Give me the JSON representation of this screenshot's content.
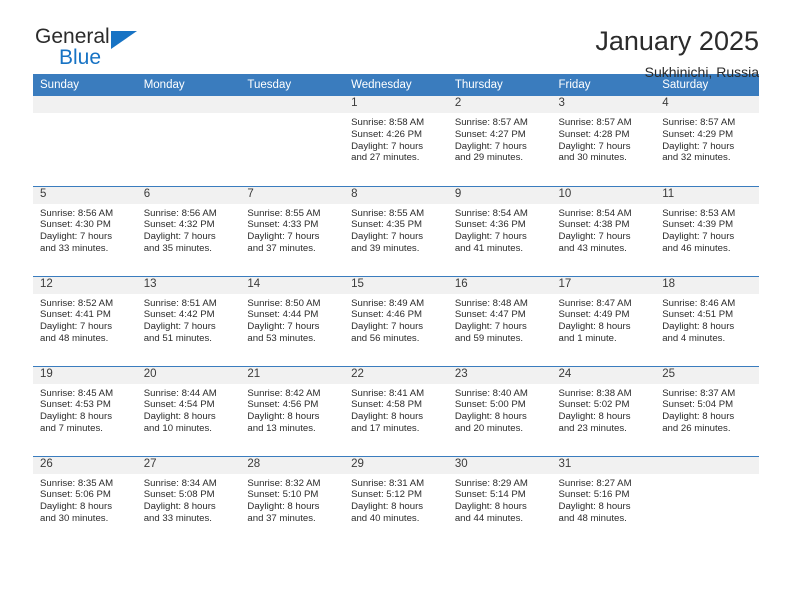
{
  "brand": {
    "name_part1": "General",
    "name_part2": "Blue",
    "accent_color": "#1773c4"
  },
  "header": {
    "title": "January 2025",
    "location": "Sukhinichi, Russia"
  },
  "calendar": {
    "header_color": "#3a7cbe",
    "weekdays": [
      "Sunday",
      "Monday",
      "Tuesday",
      "Wednesday",
      "Thursday",
      "Friday",
      "Saturday"
    ],
    "weeks": [
      [
        {
          "day": "",
          "sunrise": "",
          "sunset": "",
          "daylight_line1": "",
          "daylight_line2": ""
        },
        {
          "day": "",
          "sunrise": "",
          "sunset": "",
          "daylight_line1": "",
          "daylight_line2": ""
        },
        {
          "day": "",
          "sunrise": "",
          "sunset": "",
          "daylight_line1": "",
          "daylight_line2": ""
        },
        {
          "day": "1",
          "sunrise": "Sunrise: 8:58 AM",
          "sunset": "Sunset: 4:26 PM",
          "daylight_line1": "Daylight: 7 hours",
          "daylight_line2": "and 27 minutes."
        },
        {
          "day": "2",
          "sunrise": "Sunrise: 8:57 AM",
          "sunset": "Sunset: 4:27 PM",
          "daylight_line1": "Daylight: 7 hours",
          "daylight_line2": "and 29 minutes."
        },
        {
          "day": "3",
          "sunrise": "Sunrise: 8:57 AM",
          "sunset": "Sunset: 4:28 PM",
          "daylight_line1": "Daylight: 7 hours",
          "daylight_line2": "and 30 minutes."
        },
        {
          "day": "4",
          "sunrise": "Sunrise: 8:57 AM",
          "sunset": "Sunset: 4:29 PM",
          "daylight_line1": "Daylight: 7 hours",
          "daylight_line2": "and 32 minutes."
        }
      ],
      [
        {
          "day": "5",
          "sunrise": "Sunrise: 8:56 AM",
          "sunset": "Sunset: 4:30 PM",
          "daylight_line1": "Daylight: 7 hours",
          "daylight_line2": "and 33 minutes."
        },
        {
          "day": "6",
          "sunrise": "Sunrise: 8:56 AM",
          "sunset": "Sunset: 4:32 PM",
          "daylight_line1": "Daylight: 7 hours",
          "daylight_line2": "and 35 minutes."
        },
        {
          "day": "7",
          "sunrise": "Sunrise: 8:55 AM",
          "sunset": "Sunset: 4:33 PM",
          "daylight_line1": "Daylight: 7 hours",
          "daylight_line2": "and 37 minutes."
        },
        {
          "day": "8",
          "sunrise": "Sunrise: 8:55 AM",
          "sunset": "Sunset: 4:35 PM",
          "daylight_line1": "Daylight: 7 hours",
          "daylight_line2": "and 39 minutes."
        },
        {
          "day": "9",
          "sunrise": "Sunrise: 8:54 AM",
          "sunset": "Sunset: 4:36 PM",
          "daylight_line1": "Daylight: 7 hours",
          "daylight_line2": "and 41 minutes."
        },
        {
          "day": "10",
          "sunrise": "Sunrise: 8:54 AM",
          "sunset": "Sunset: 4:38 PM",
          "daylight_line1": "Daylight: 7 hours",
          "daylight_line2": "and 43 minutes."
        },
        {
          "day": "11",
          "sunrise": "Sunrise: 8:53 AM",
          "sunset": "Sunset: 4:39 PM",
          "daylight_line1": "Daylight: 7 hours",
          "daylight_line2": "and 46 minutes."
        }
      ],
      [
        {
          "day": "12",
          "sunrise": "Sunrise: 8:52 AM",
          "sunset": "Sunset: 4:41 PM",
          "daylight_line1": "Daylight: 7 hours",
          "daylight_line2": "and 48 minutes."
        },
        {
          "day": "13",
          "sunrise": "Sunrise: 8:51 AM",
          "sunset": "Sunset: 4:42 PM",
          "daylight_line1": "Daylight: 7 hours",
          "daylight_line2": "and 51 minutes."
        },
        {
          "day": "14",
          "sunrise": "Sunrise: 8:50 AM",
          "sunset": "Sunset: 4:44 PM",
          "daylight_line1": "Daylight: 7 hours",
          "daylight_line2": "and 53 minutes."
        },
        {
          "day": "15",
          "sunrise": "Sunrise: 8:49 AM",
          "sunset": "Sunset: 4:46 PM",
          "daylight_line1": "Daylight: 7 hours",
          "daylight_line2": "and 56 minutes."
        },
        {
          "day": "16",
          "sunrise": "Sunrise: 8:48 AM",
          "sunset": "Sunset: 4:47 PM",
          "daylight_line1": "Daylight: 7 hours",
          "daylight_line2": "and 59 minutes."
        },
        {
          "day": "17",
          "sunrise": "Sunrise: 8:47 AM",
          "sunset": "Sunset: 4:49 PM",
          "daylight_line1": "Daylight: 8 hours",
          "daylight_line2": "and 1 minute."
        },
        {
          "day": "18",
          "sunrise": "Sunrise: 8:46 AM",
          "sunset": "Sunset: 4:51 PM",
          "daylight_line1": "Daylight: 8 hours",
          "daylight_line2": "and 4 minutes."
        }
      ],
      [
        {
          "day": "19",
          "sunrise": "Sunrise: 8:45 AM",
          "sunset": "Sunset: 4:53 PM",
          "daylight_line1": "Daylight: 8 hours",
          "daylight_line2": "and 7 minutes."
        },
        {
          "day": "20",
          "sunrise": "Sunrise: 8:44 AM",
          "sunset": "Sunset: 4:54 PM",
          "daylight_line1": "Daylight: 8 hours",
          "daylight_line2": "and 10 minutes."
        },
        {
          "day": "21",
          "sunrise": "Sunrise: 8:42 AM",
          "sunset": "Sunset: 4:56 PM",
          "daylight_line1": "Daylight: 8 hours",
          "daylight_line2": "and 13 minutes."
        },
        {
          "day": "22",
          "sunrise": "Sunrise: 8:41 AM",
          "sunset": "Sunset: 4:58 PM",
          "daylight_line1": "Daylight: 8 hours",
          "daylight_line2": "and 17 minutes."
        },
        {
          "day": "23",
          "sunrise": "Sunrise: 8:40 AM",
          "sunset": "Sunset: 5:00 PM",
          "daylight_line1": "Daylight: 8 hours",
          "daylight_line2": "and 20 minutes."
        },
        {
          "day": "24",
          "sunrise": "Sunrise: 8:38 AM",
          "sunset": "Sunset: 5:02 PM",
          "daylight_line1": "Daylight: 8 hours",
          "daylight_line2": "and 23 minutes."
        },
        {
          "day": "25",
          "sunrise": "Sunrise: 8:37 AM",
          "sunset": "Sunset: 5:04 PM",
          "daylight_line1": "Daylight: 8 hours",
          "daylight_line2": "and 26 minutes."
        }
      ],
      [
        {
          "day": "26",
          "sunrise": "Sunrise: 8:35 AM",
          "sunset": "Sunset: 5:06 PM",
          "daylight_line1": "Daylight: 8 hours",
          "daylight_line2": "and 30 minutes."
        },
        {
          "day": "27",
          "sunrise": "Sunrise: 8:34 AM",
          "sunset": "Sunset: 5:08 PM",
          "daylight_line1": "Daylight: 8 hours",
          "daylight_line2": "and 33 minutes."
        },
        {
          "day": "28",
          "sunrise": "Sunrise: 8:32 AM",
          "sunset": "Sunset: 5:10 PM",
          "daylight_line1": "Daylight: 8 hours",
          "daylight_line2": "and 37 minutes."
        },
        {
          "day": "29",
          "sunrise": "Sunrise: 8:31 AM",
          "sunset": "Sunset: 5:12 PM",
          "daylight_line1": "Daylight: 8 hours",
          "daylight_line2": "and 40 minutes."
        },
        {
          "day": "30",
          "sunrise": "Sunrise: 8:29 AM",
          "sunset": "Sunset: 5:14 PM",
          "daylight_line1": "Daylight: 8 hours",
          "daylight_line2": "and 44 minutes."
        },
        {
          "day": "31",
          "sunrise": "Sunrise: 8:27 AM",
          "sunset": "Sunset: 5:16 PM",
          "daylight_line1": "Daylight: 8 hours",
          "daylight_line2": "and 48 minutes."
        },
        {
          "day": "",
          "sunrise": "",
          "sunset": "",
          "daylight_line1": "",
          "daylight_line2": ""
        }
      ]
    ]
  }
}
